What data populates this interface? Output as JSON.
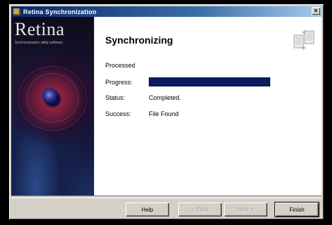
{
  "window": {
    "title": "Retina Synchronization",
    "close_glyph": "×"
  },
  "banner": {
    "title": "Retina",
    "subtitle": "Synchronization utility software"
  },
  "main": {
    "heading": "Synchronizing",
    "processed_label": "Processed",
    "progress_label": "Progress:",
    "progress_value": 0.9,
    "progress_color": "#0a1a5a",
    "status_label": "Status:",
    "status_value": "Completed.",
    "success_label": "Success:",
    "success_value": "File Found",
    "icon": "sync-devices-icon"
  },
  "buttons": {
    "help": "Help",
    "back": "< Back",
    "next": "Next >",
    "finish": "Finish"
  }
}
